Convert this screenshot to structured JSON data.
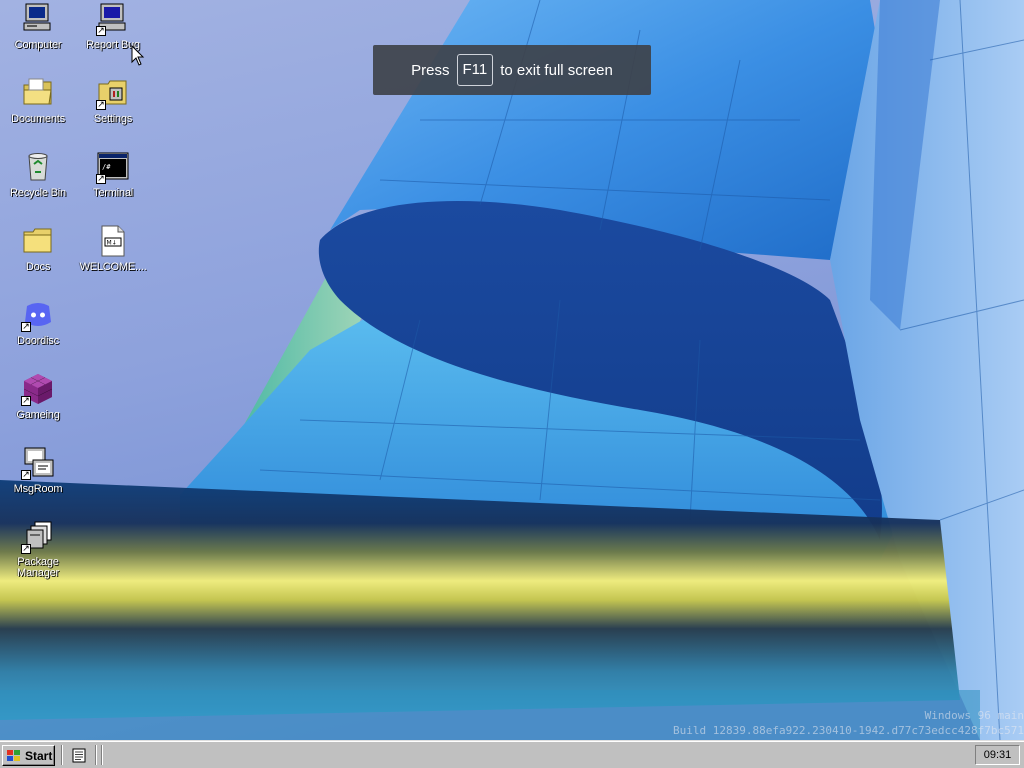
{
  "desktop_icons": [
    {
      "label": "Computer",
      "icon": "computer-icon",
      "shortcut": false
    },
    {
      "label": "Report Bug",
      "icon": "report-bug-icon",
      "shortcut": true
    },
    {
      "label": "Documents",
      "icon": "folder-open-icon",
      "shortcut": false
    },
    {
      "label": "Settings",
      "icon": "settings-folder-icon",
      "shortcut": true
    },
    {
      "label": "Recycle Bin",
      "icon": "recycle-bin-icon",
      "shortcut": false
    },
    {
      "label": "Terminal",
      "icon": "terminal-icon",
      "shortcut": true
    },
    {
      "label": "Docs",
      "icon": "folder-icon",
      "shortcut": false
    },
    {
      "label": "WELCOME....",
      "icon": "markdown-file-icon",
      "shortcut": false
    },
    {
      "label": "Doordisc",
      "icon": "doordisc-icon",
      "shortcut": true
    },
    {
      "label": "Gameing",
      "icon": "cube-icon",
      "shortcut": true
    },
    {
      "label": "MsgRoom",
      "icon": "msgroom-icon",
      "shortcut": true
    },
    {
      "label": "Package Manager",
      "icon": "package-manager-icon",
      "shortcut": true
    }
  ],
  "fullscreen_toast": {
    "prefix": "Press",
    "key": "F11",
    "suffix": "to exit full screen"
  },
  "watermark": {
    "line1": "Windows 96 main",
    "line2": "Build 12839.88efa922.230410-1942.d77c73edcc428f7bc571"
  },
  "taskbar": {
    "start_label": "Start",
    "clock": "09:31"
  },
  "colors": {
    "taskbar_bg": "#c0c0c0",
    "toast_bg": "#3e424a",
    "sky_blue": "#8fa3dc",
    "building_blue": "#3f8fe0"
  }
}
